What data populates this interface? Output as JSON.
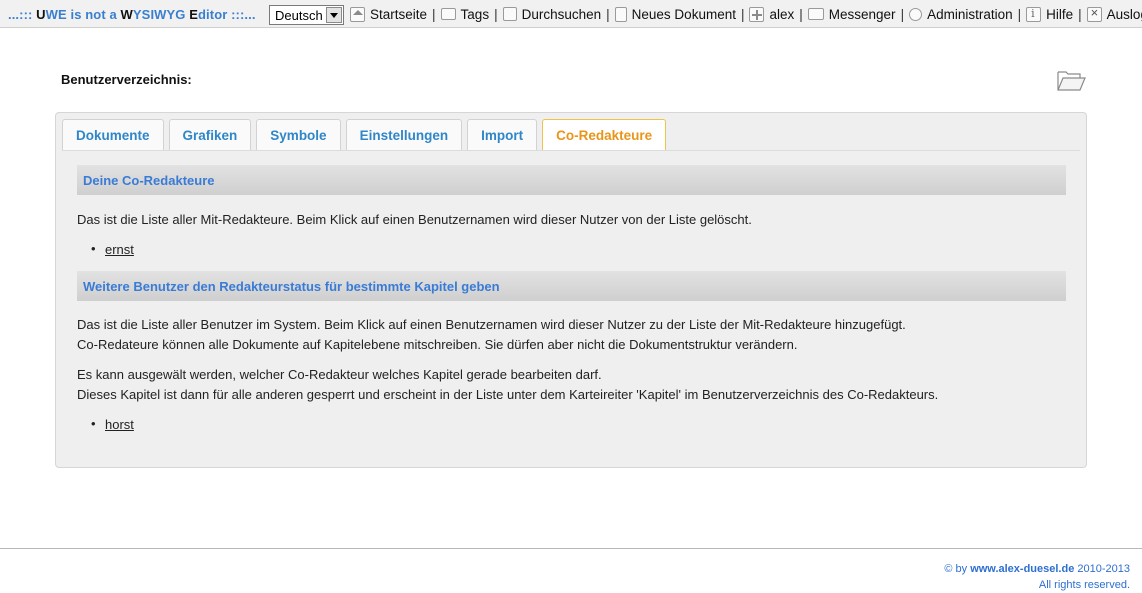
{
  "topbar": {
    "brand_dots_left": "...:::",
    "brand_u": "U",
    "brand_we": "WE is not a ",
    "brand_w": "W",
    "brand_ysiwyg": "YSIWYG ",
    "brand_e": "E",
    "brand_ditor": "ditor",
    "brand_dots_right": ":::...",
    "language": "Deutsch",
    "nav": [
      {
        "label": "Startseite",
        "icon": "home-icon"
      },
      {
        "label": "Tags",
        "icon": "tag-icon"
      },
      {
        "label": "Durchsuchen",
        "icon": "search-icon"
      },
      {
        "label": "Neues Dokument",
        "icon": "document-icon"
      },
      {
        "label": "alex",
        "icon": "user-icon"
      },
      {
        "label": "Messenger",
        "icon": "message-icon"
      },
      {
        "label": "Administration",
        "icon": "gear-icon"
      },
      {
        "label": "Hilfe",
        "icon": "info-icon"
      },
      {
        "label": "Ausloggen",
        "icon": "close-icon"
      }
    ],
    "separator": "|"
  },
  "page": {
    "title": "Benutzerverzeichnis:",
    "folder_icon": "folder-open-icon"
  },
  "tabs": [
    {
      "label": "Dokumente",
      "active": false
    },
    {
      "label": "Grafiken",
      "active": false
    },
    {
      "label": "Symbole",
      "active": false
    },
    {
      "label": "Einstellungen",
      "active": false
    },
    {
      "label": "Import",
      "active": false
    },
    {
      "label": "Co-Redakteure",
      "active": true
    }
  ],
  "section1": {
    "heading": "Deine Co-Redakteure",
    "text": "Das ist die Liste aller Mit-Redakteure. Beim Klick auf einen Benutzernamen wird dieser Nutzer von der Liste gelöscht.",
    "users": [
      "ernst"
    ]
  },
  "section2": {
    "heading": "Weitere Benutzer den Redakteurstatus für bestimmte Kapitel geben",
    "text1": "Das ist die Liste aller Benutzer im System. Beim Klick auf einen Benutzernamen wird dieser Nutzer zu der Liste der Mit-Redakteure hinzugefügt.",
    "text2": "Co-Redateure können alle Dokumente auf Kapitelebene mitschreiben. Sie dürfen aber nicht die Dokumentstruktur verändern.",
    "text3": "Es kann ausgewält werden, welcher Co-Redakteur welches Kapitel gerade bearbeiten darf.",
    "text4": "Dieses Kapitel ist dann für alle anderen gesperrt und erscheint in der Liste unter dem Karteireiter 'Kapitel' im Benutzerverzeichnis des Co-Redakteurs.",
    "users": [
      "horst"
    ]
  },
  "footer": {
    "copyright": "© by ",
    "site": "www.alex-duesel.de",
    "years": " 2010-2013",
    "rights": "All rights reserved."
  },
  "colors": {
    "accent_blue": "#3a7bd5",
    "tab_blue": "#2f86c8",
    "active_tab_orange": "#e8951a"
  }
}
